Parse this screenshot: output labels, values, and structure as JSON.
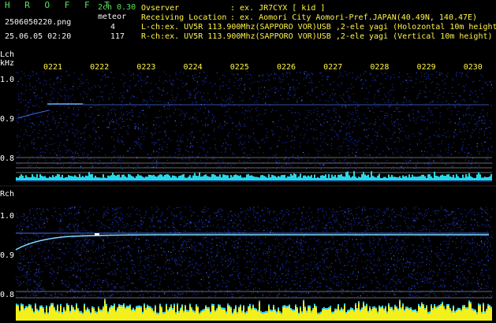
{
  "header": {
    "app_title": "H R O F F T",
    "version": "2ch 0.30",
    "filename": "2506050220.png",
    "meteor_label": "meteor",
    "meteor_count_l": "4",
    "meteor_count_r": "117",
    "datetime": "25.06.05 02:20",
    "observer_key": "Ovserver",
    "observer_sep": ": ex. JR7CYX [ kid ]",
    "location_key": "Receiving Location",
    "location_sep": ": ex. Aomori City Aomori-Pref.JAPAN(40.49N, 140.47E)",
    "lch_info": "L-ch:ex. UV5R 113.900Mhz(SAPPORO VOR)USB ,2-ele yagi (Holozontal 10m height)",
    "rch_info": "R-ch:ex. UV5R 113.900Mhz(SAPPORO VOR)USB ,2-ele yagi (Vertical 10m height)"
  },
  "lch": {
    "label": "Lch",
    "unit": "kHz",
    "y_ticks": [
      "1.0",
      "0.9",
      "0.8"
    ]
  },
  "rch": {
    "label": "Rch",
    "y_ticks": [
      "1.0",
      "0.9",
      "0.8"
    ]
  },
  "time_ticks": [
    "0221",
    "0222",
    "0223",
    "0224",
    "0225",
    "0226",
    "0227",
    "0228",
    "0229",
    "0230"
  ],
  "colors": {
    "background": "#000000",
    "noise": "#1a2a9a",
    "signal": "#7fd8ff",
    "lch_meter": "#27d8e8",
    "rch_meter": "#f4f01c",
    "rch_meter_top": "#2bd8ff",
    "tick_label": "#fff44a",
    "title": "#58e35a"
  }
}
